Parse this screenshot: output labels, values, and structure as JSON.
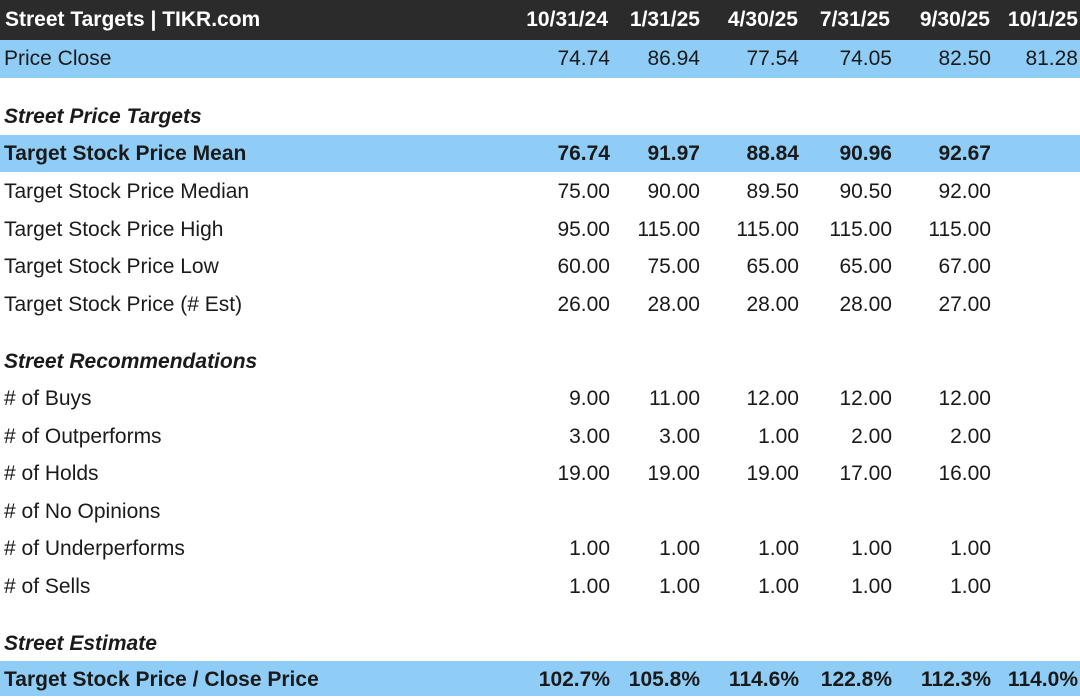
{
  "header": {
    "title": "Street Targets | TIKR.com",
    "dates": [
      "10/31/24",
      "1/31/25",
      "4/30/25",
      "7/31/25",
      "9/30/25",
      "10/1/25"
    ]
  },
  "price_close": {
    "label": "Price Close",
    "values": [
      "74.74",
      "86.94",
      "77.54",
      "74.05",
      "82.50",
      "81.28"
    ]
  },
  "sections": {
    "targets": "Street Price Targets",
    "recommendations": "Street Recommendations",
    "estimate": "Street Estimate"
  },
  "targets": [
    {
      "label": "Target Stock Price Mean",
      "values": [
        "76.74",
        "91.97",
        "88.84",
        "90.96",
        "92.67",
        ""
      ]
    },
    {
      "label": "Target Stock Price Median",
      "values": [
        "75.00",
        "90.00",
        "89.50",
        "90.50",
        "92.00",
        ""
      ]
    },
    {
      "label": "Target Stock Price High",
      "values": [
        "95.00",
        "115.00",
        "115.00",
        "115.00",
        "115.00",
        ""
      ]
    },
    {
      "label": "Target Stock Price Low",
      "values": [
        "60.00",
        "75.00",
        "65.00",
        "65.00",
        "67.00",
        ""
      ]
    },
    {
      "label": "Target Stock Price (# Est)",
      "values": [
        "26.00",
        "28.00",
        "28.00",
        "28.00",
        "27.00",
        ""
      ]
    }
  ],
  "recommendations": [
    {
      "label": "# of Buys",
      "values": [
        "9.00",
        "11.00",
        "12.00",
        "12.00",
        "12.00",
        ""
      ]
    },
    {
      "label": "# of Outperforms",
      "values": [
        "3.00",
        "3.00",
        "1.00",
        "2.00",
        "2.00",
        ""
      ]
    },
    {
      "label": "# of Holds",
      "values": [
        "19.00",
        "19.00",
        "19.00",
        "17.00",
        "16.00",
        ""
      ]
    },
    {
      "label": "# of No Opinions",
      "values": [
        "",
        "",
        "",
        "",
        "",
        ""
      ]
    },
    {
      "label": "# of Underperforms",
      "values": [
        "1.00",
        "1.00",
        "1.00",
        "1.00",
        "1.00",
        ""
      ]
    },
    {
      "label": "# of Sells",
      "values": [
        "1.00",
        "1.00",
        "1.00",
        "1.00",
        "1.00",
        ""
      ]
    }
  ],
  "estimate": {
    "label": "Target Stock Price / Close Price",
    "values": [
      "102.7%",
      "105.8%",
      "114.6%",
      "122.8%",
      "112.3%",
      "114.0%"
    ]
  },
  "colors": {
    "header_bg": "#2b2b2b",
    "highlight_bg": "#8fcdf7"
  }
}
